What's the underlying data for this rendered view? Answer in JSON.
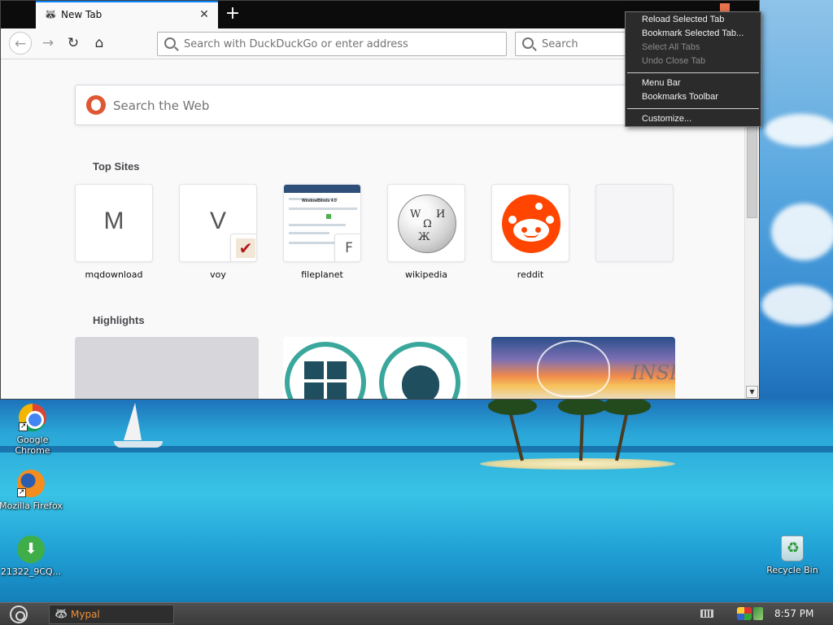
{
  "browser": {
    "tab": {
      "title": "New Tab",
      "close_symbol": "✕"
    },
    "newtab_symbol": "+",
    "urlbar": {
      "placeholder": "Search with DuckDuckGo or enter address"
    },
    "searchbar": {
      "placeholder": "Search"
    },
    "icons": {
      "back": "←",
      "forward": "→",
      "reload": "↻",
      "home": "⌂"
    },
    "accent_color": "#0a84ff"
  },
  "newtab": {
    "websearch_placeholder": "Search the Web",
    "top_sites_title": "Top Sites",
    "highlights_title": "Highlights",
    "top_sites": [
      {
        "label": "mqdownload",
        "letter": "M"
      },
      {
        "label": "voy",
        "letter": "V"
      },
      {
        "label": "fileplanet",
        "letter": "F",
        "preview_title": "WindowBlinds 4.0"
      },
      {
        "label": "wikipedia",
        "glyphs": [
          "Ω",
          "W",
          "И",
          "Ж"
        ]
      },
      {
        "label": "reddit"
      },
      {
        "label": ""
      }
    ],
    "highlights": [
      {
        "kind": "empty"
      },
      {
        "kind": "windows-apple-logos"
      },
      {
        "kind": "art",
        "text": "INSPI"
      }
    ]
  },
  "context_menu": {
    "items": [
      {
        "label": "Reload Selected Tab",
        "enabled": true
      },
      {
        "label": "Bookmark Selected Tab...",
        "enabled": true
      },
      {
        "label": "Select All Tabs",
        "enabled": false
      },
      {
        "label": "Undo Close Tab",
        "enabled": false
      },
      {
        "label": "Menu Bar",
        "enabled": true
      },
      {
        "label": "Bookmarks Toolbar",
        "enabled": true
      },
      {
        "label": "Customize...",
        "enabled": true
      }
    ]
  },
  "desktop": {
    "icons": [
      {
        "label": "Google Chrome",
        "icon": "chrome-icon"
      },
      {
        "label": "Mozilla Firefox",
        "icon": "firefox-icon"
      },
      {
        "label": "21322_9CQ...",
        "icon": "download-icon"
      },
      {
        "label": "Recycle Bin",
        "icon": "recycle-bin-icon"
      }
    ],
    "shortcut_arrow": "↗"
  },
  "taskbar": {
    "task_label": "Mypal",
    "task_icon": "🦝",
    "clock": "8:57 PM"
  }
}
